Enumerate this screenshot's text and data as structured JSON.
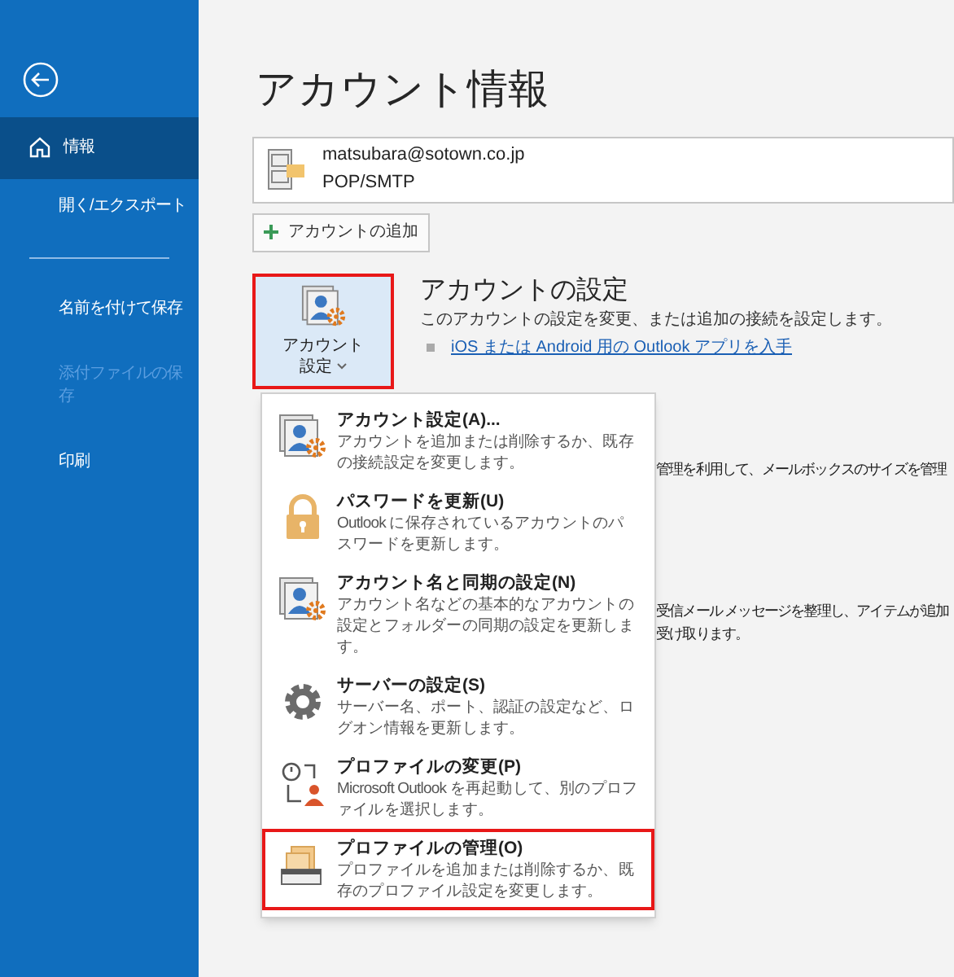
{
  "sidebar": {
    "items": [
      {
        "label": "情報",
        "selected": true,
        "disabled": false,
        "kind": "home"
      },
      {
        "label": "開く/エクスポート",
        "selected": false,
        "disabled": false,
        "kind": "text"
      },
      {
        "kind": "divider"
      },
      {
        "label": "名前を付けて保存",
        "selected": false,
        "disabled": false,
        "kind": "text"
      },
      {
        "label": "添付ファイルの保存",
        "selected": false,
        "disabled": true,
        "kind": "text"
      },
      {
        "label": "印刷",
        "selected": false,
        "disabled": false,
        "kind": "text"
      }
    ]
  },
  "title": "アカウント情報",
  "account": {
    "email": "matsubara@sotown.co.jp",
    "type": "POP/SMTP"
  },
  "add_account_button": "アカウントの追加",
  "account_settings": {
    "button_label": "アカウント設定",
    "heading": "アカウントの設定",
    "description": "このアカウントの設定を変更、または追加の接続を設定します。",
    "link": "iOS または Android 用の Outlook アプリを入手"
  },
  "background_texts": [
    {
      "text": "管理を利用して、メールボックスのサイズを管理"
    },
    {
      "text": "受信メール メッセージを整理し、アイテムが追加"
    },
    {
      "text": "受け取ります。"
    }
  ],
  "menu": [
    {
      "kind": "account",
      "title": "アカウント設定(A)...",
      "description": "アカウントを追加または削除するか、既存の接続設定を変更します。",
      "highlighted": false
    },
    {
      "kind": "lock",
      "title": "パスワードを更新(U)",
      "description": "Outlook に保存されているアカウントのパスワードを更新します。",
      "highlighted": false
    },
    {
      "kind": "account",
      "title": "アカウント名と同期の設定(N)",
      "description": "アカウント名などの基本的なアカウントの設定とフォルダーの同期の設定を更新します。",
      "highlighted": false
    },
    {
      "kind": "gear",
      "title": "サーバーの設定(S)",
      "description": "サーバー名、ポート、認証の設定など、ログオン情報を更新します。",
      "highlighted": false
    },
    {
      "kind": "profile",
      "title": "プロファイルの変更(P)",
      "description": "Microsoft Outlook を再起動して、別のプロファイルを選択します。",
      "highlighted": false
    },
    {
      "kind": "manage",
      "title": "プロファイルの管理(O)",
      "description": "プロファイルを追加または削除するか、既存のプロファイル設定を変更します。",
      "highlighted": true
    }
  ]
}
